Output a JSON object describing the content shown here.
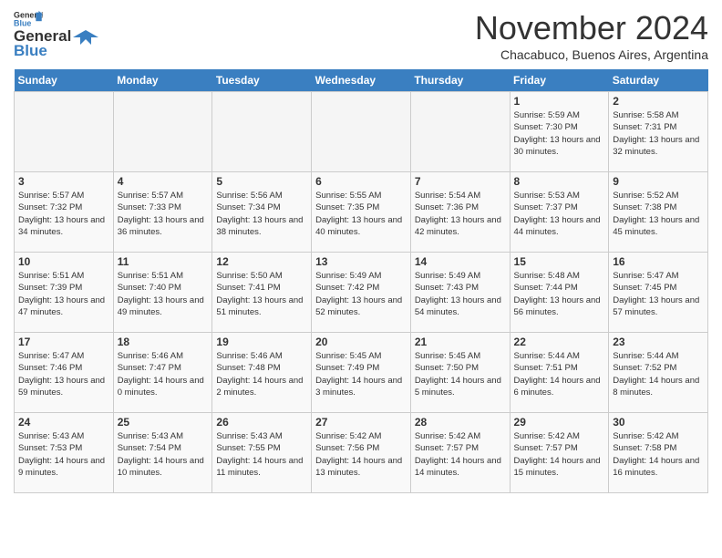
{
  "header": {
    "logo_line1": "General",
    "logo_line2": "Blue",
    "month": "November 2024",
    "location": "Chacabuco, Buenos Aires, Argentina"
  },
  "weekdays": [
    "Sunday",
    "Monday",
    "Tuesday",
    "Wednesday",
    "Thursday",
    "Friday",
    "Saturday"
  ],
  "weeks": [
    [
      {
        "day": "",
        "empty": true
      },
      {
        "day": "",
        "empty": true
      },
      {
        "day": "",
        "empty": true
      },
      {
        "day": "",
        "empty": true
      },
      {
        "day": "",
        "empty": true
      },
      {
        "day": "1",
        "sunrise": "5:59 AM",
        "sunset": "7:30 PM",
        "daylight": "13 hours and 30 minutes."
      },
      {
        "day": "2",
        "sunrise": "5:58 AM",
        "sunset": "7:31 PM",
        "daylight": "13 hours and 32 minutes."
      }
    ],
    [
      {
        "day": "3",
        "sunrise": "5:57 AM",
        "sunset": "7:32 PM",
        "daylight": "13 hours and 34 minutes."
      },
      {
        "day": "4",
        "sunrise": "5:57 AM",
        "sunset": "7:33 PM",
        "daylight": "13 hours and 36 minutes."
      },
      {
        "day": "5",
        "sunrise": "5:56 AM",
        "sunset": "7:34 PM",
        "daylight": "13 hours and 38 minutes."
      },
      {
        "day": "6",
        "sunrise": "5:55 AM",
        "sunset": "7:35 PM",
        "daylight": "13 hours and 40 minutes."
      },
      {
        "day": "7",
        "sunrise": "5:54 AM",
        "sunset": "7:36 PM",
        "daylight": "13 hours and 42 minutes."
      },
      {
        "day": "8",
        "sunrise": "5:53 AM",
        "sunset": "7:37 PM",
        "daylight": "13 hours and 44 minutes."
      },
      {
        "day": "9",
        "sunrise": "5:52 AM",
        "sunset": "7:38 PM",
        "daylight": "13 hours and 45 minutes."
      }
    ],
    [
      {
        "day": "10",
        "sunrise": "5:51 AM",
        "sunset": "7:39 PM",
        "daylight": "13 hours and 47 minutes."
      },
      {
        "day": "11",
        "sunrise": "5:51 AM",
        "sunset": "7:40 PM",
        "daylight": "13 hours and 49 minutes."
      },
      {
        "day": "12",
        "sunrise": "5:50 AM",
        "sunset": "7:41 PM",
        "daylight": "13 hours and 51 minutes."
      },
      {
        "day": "13",
        "sunrise": "5:49 AM",
        "sunset": "7:42 PM",
        "daylight": "13 hours and 52 minutes."
      },
      {
        "day": "14",
        "sunrise": "5:49 AM",
        "sunset": "7:43 PM",
        "daylight": "13 hours and 54 minutes."
      },
      {
        "day": "15",
        "sunrise": "5:48 AM",
        "sunset": "7:44 PM",
        "daylight": "13 hours and 56 minutes."
      },
      {
        "day": "16",
        "sunrise": "5:47 AM",
        "sunset": "7:45 PM",
        "daylight": "13 hours and 57 minutes."
      }
    ],
    [
      {
        "day": "17",
        "sunrise": "5:47 AM",
        "sunset": "7:46 PM",
        "daylight": "13 hours and 59 minutes."
      },
      {
        "day": "18",
        "sunrise": "5:46 AM",
        "sunset": "7:47 PM",
        "daylight": "14 hours and 0 minutes."
      },
      {
        "day": "19",
        "sunrise": "5:46 AM",
        "sunset": "7:48 PM",
        "daylight": "14 hours and 2 minutes."
      },
      {
        "day": "20",
        "sunrise": "5:45 AM",
        "sunset": "7:49 PM",
        "daylight": "14 hours and 3 minutes."
      },
      {
        "day": "21",
        "sunrise": "5:45 AM",
        "sunset": "7:50 PM",
        "daylight": "14 hours and 5 minutes."
      },
      {
        "day": "22",
        "sunrise": "5:44 AM",
        "sunset": "7:51 PM",
        "daylight": "14 hours and 6 minutes."
      },
      {
        "day": "23",
        "sunrise": "5:44 AM",
        "sunset": "7:52 PM",
        "daylight": "14 hours and 8 minutes."
      }
    ],
    [
      {
        "day": "24",
        "sunrise": "5:43 AM",
        "sunset": "7:53 PM",
        "daylight": "14 hours and 9 minutes."
      },
      {
        "day": "25",
        "sunrise": "5:43 AM",
        "sunset": "7:54 PM",
        "daylight": "14 hours and 10 minutes."
      },
      {
        "day": "26",
        "sunrise": "5:43 AM",
        "sunset": "7:55 PM",
        "daylight": "14 hours and 11 minutes."
      },
      {
        "day": "27",
        "sunrise": "5:42 AM",
        "sunset": "7:56 PM",
        "daylight": "14 hours and 13 minutes."
      },
      {
        "day": "28",
        "sunrise": "5:42 AM",
        "sunset": "7:57 PM",
        "daylight": "14 hours and 14 minutes."
      },
      {
        "day": "29",
        "sunrise": "5:42 AM",
        "sunset": "7:57 PM",
        "daylight": "14 hours and 15 minutes."
      },
      {
        "day": "30",
        "sunrise": "5:42 AM",
        "sunset": "7:58 PM",
        "daylight": "14 hours and 16 minutes."
      }
    ]
  ]
}
